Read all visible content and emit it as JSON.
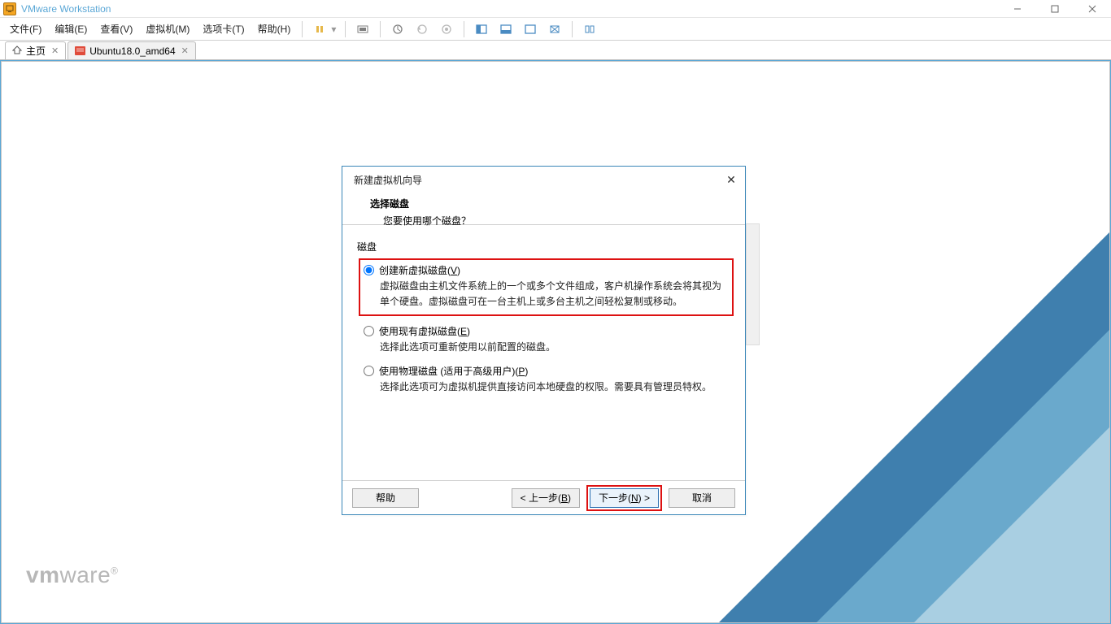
{
  "titlebar": {
    "title": "VMware Workstation"
  },
  "menu": {
    "file": "文件(F)",
    "edit": "编辑(E)",
    "view": "查看(V)",
    "vm": "虚拟机(M)",
    "tabs": "选项卡(T)",
    "help": "帮助(H)"
  },
  "tabs": {
    "home": "主页",
    "vm1": "Ubuntu18.0_amd64"
  },
  "logo": {
    "prefix": "vm",
    "suffix": "ware",
    "reg": "®"
  },
  "dialog": {
    "title": "新建虚拟机向导",
    "section": "选择磁盘",
    "question": "您要使用哪个磁盘？",
    "group": "磁盘",
    "opt1": {
      "label_pre": "创建新虚拟磁盘(",
      "accel": "V",
      "label_post": ")",
      "desc": "虚拟磁盘由主机文件系统上的一个或多个文件组成，客户机操作系统会将其视为单个硬盘。虚拟磁盘可在一台主机上或多台主机之间轻松复制或移动。"
    },
    "opt2": {
      "label_pre": "使用现有虚拟磁盘(",
      "accel": "E",
      "label_post": ")",
      "desc": "选择此选项可重新使用以前配置的磁盘。"
    },
    "opt3": {
      "label_pre": "使用物理磁盘 (适用于高级用户)(",
      "accel": "P",
      "label_post": ")",
      "desc": "选择此选项可为虚拟机提供直接访问本地硬盘的权限。需要具有管理员特权。"
    },
    "buttons": {
      "help": "帮助",
      "back_pre": "< 上一步(",
      "back_accel": "B",
      "back_post": ")",
      "next_pre": "下一步(",
      "next_accel": "N",
      "next_post": ") >",
      "cancel": "取消"
    }
  }
}
